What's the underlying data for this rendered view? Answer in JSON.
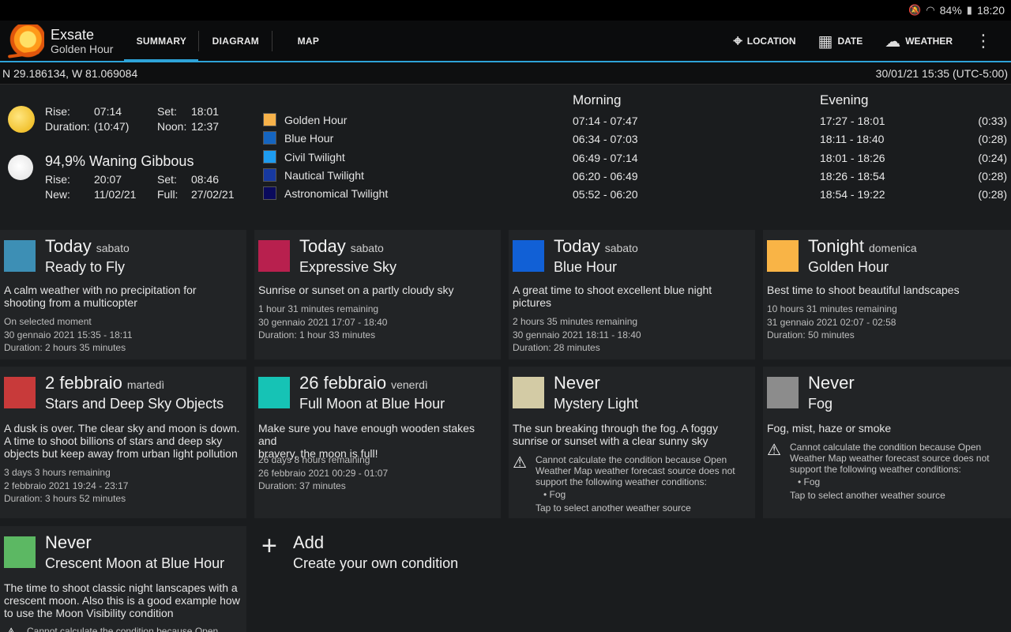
{
  "status": {
    "battery": "84%",
    "time": "18:20"
  },
  "app": {
    "name": "Exsate",
    "subtitle": "Golden Hour"
  },
  "tabs": [
    {
      "label": "SUMMARY"
    },
    {
      "label": "DIAGRAM"
    },
    {
      "label": "MAP"
    }
  ],
  "actions": {
    "location": "LOCATION",
    "date": "DATE",
    "weather": "WEATHER"
  },
  "coords": {
    "position": "N 29.186134, W 81.069084",
    "datetime": "30/01/21 15:35 (UTC-5:00)"
  },
  "sun": {
    "rise_label": "Rise:",
    "rise": "07:14",
    "set_label": "Set:",
    "set": "18:01",
    "duration_label": "Duration:",
    "duration": "(10:47)",
    "noon_label": "Noon:",
    "noon": "12:37"
  },
  "moon": {
    "phase": "94,9% Waning Gibbous",
    "rise_label": "Rise:",
    "rise": "20:07",
    "set_label": "Set:",
    "set": "08:46",
    "new_label": "New:",
    "new": "11/02/21",
    "full_label": "Full:",
    "full": "27/02/21"
  },
  "legend": [
    {
      "label": "Golden Hour",
      "color": "#f7b24a"
    },
    {
      "label": "Blue Hour",
      "color": "#1565c0"
    },
    {
      "label": "Civil Twilight",
      "color": "#1e9cf0"
    },
    {
      "label": "Nautical Twilight",
      "color": "#1739a0"
    },
    {
      "label": "Astronomical Twilight",
      "color": "#0a0a5c"
    }
  ],
  "schedule": {
    "morning_header": "Morning",
    "evening_header": "Evening",
    "morning": [
      "07:14 - 07:47",
      "06:34 - 07:03",
      "06:49 - 07:14",
      "06:20 - 06:49",
      "05:52 - 06:20"
    ],
    "evening": [
      "17:27 - 18:01",
      "18:11 - 18:40",
      "18:01 - 18:26",
      "18:26 - 18:54",
      "18:54 - 19:22"
    ],
    "durations": [
      "(0:33)",
      "(0:28)",
      "(0:24)",
      "(0:28)",
      "(0:28)"
    ]
  },
  "cards": [
    {
      "when": "Today",
      "day": "sabato",
      "title": "Ready to Fly",
      "color": "#3d8fb5",
      "desc": [
        "A calm weather with no precipitation for",
        "shooting from a multicopter"
      ],
      "meta": [
        "On selected moment",
        "30 gennaio 2021 15:35 - 18:11",
        "Duration: 2 hours 35 minutes"
      ]
    },
    {
      "when": "Today",
      "day": "sabato",
      "title": "Expressive Sky",
      "color": "#b8204e",
      "desc": [
        "Sunrise or sunset on a partly cloudy sky"
      ],
      "meta": [
        "1 hour 31 minutes remaining",
        "30 gennaio 2021 17:07 - 18:40",
        "Duration: 1 hour 33 minutes"
      ]
    },
    {
      "when": "Today",
      "day": "sabato",
      "title": "Blue Hour",
      "color": "#1160d6",
      "desc": [
        "A great time to shoot excellent blue night",
        "pictures"
      ],
      "meta": [
        "2 hours 35 minutes remaining",
        "30 gennaio 2021 18:11 - 18:40",
        "Duration: 28 minutes"
      ]
    },
    {
      "when": "Tonight",
      "day": "domenica",
      "title": "Golden Hour",
      "color": "#f9b446",
      "desc": [
        "Best time to shoot beautiful landscapes"
      ],
      "meta": [
        "10 hours 31 minutes remaining",
        "31 gennaio 2021 02:07 - 02:58",
        "Duration: 50 minutes"
      ]
    },
    {
      "when": "2 febbraio",
      "day": "martedì",
      "title": "Stars and Deep Sky Objects",
      "color": "#c83a3a",
      "desc": [
        "A dusk is over. The clear sky and moon is down.",
        "A time to shoot billions of stars and deep sky",
        "objects but keep away from urban light pollution"
      ],
      "meta": [
        "3 days 3 hours remaining",
        "2 febbraio 2021 19:24 - 23:17",
        "Duration: 3 hours 52 minutes"
      ]
    },
    {
      "when": "26 febbraio",
      "day": "venerdì",
      "title": "Full Moon at Blue Hour",
      "color": "#16c3b5",
      "desc": [
        "Make sure you have enough wooden stakes and",
        "bravery, the moon is full!"
      ],
      "meta": [
        "26 days 8 hours remaining",
        "26 febbraio 2021 00:29 - 01:07",
        "Duration: 37 minutes"
      ]
    },
    {
      "when": "Never",
      "day": "",
      "title": "Mystery Light",
      "color": "#d3cba5",
      "desc": [
        "The sun breaking through the fog. A foggy",
        "sunrise or sunset with a clear sunny sky"
      ],
      "warning": [
        "Cannot calculate the condition because Open",
        "Weather Map weather forecast source does not",
        "support the following weather conditions:"
      ],
      "bullet": "• Fog",
      "tap": "Tap to select another weather source"
    },
    {
      "when": "Never",
      "day": "",
      "title": "Fog",
      "color": "#8c8c8c",
      "desc": [
        "Fog, mist, haze or smoke"
      ],
      "warning": [
        "Cannot calculate the condition because Open",
        "Weather Map weather forecast source does not",
        "support the following weather conditions:"
      ],
      "bullet": "• Fog",
      "tap": "Tap to select another weather source"
    },
    {
      "when": "Never",
      "day": "",
      "title": "Crescent Moon at Blue Hour",
      "color": "#5cb863",
      "desc": [
        "The time to shoot classic night lanscapes with a",
        "crescent moon. Also this is a good example how",
        "to use the Moon Visibility condition"
      ],
      "warning": [
        "Cannot calculate the condition because Open"
      ]
    }
  ],
  "add": {
    "label": "Add",
    "sublabel": "Create your own condition"
  }
}
